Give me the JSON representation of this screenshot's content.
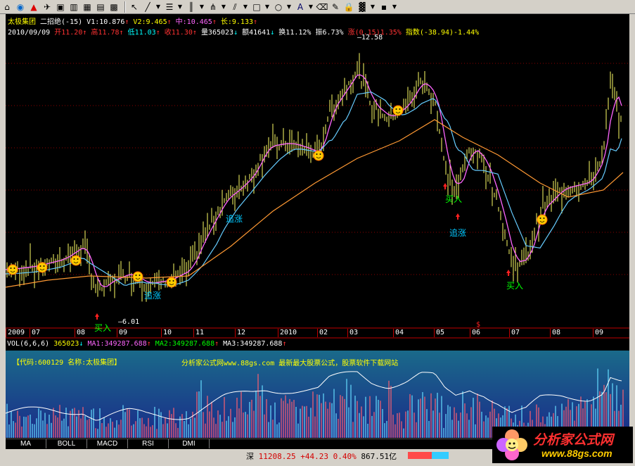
{
  "toolbar": {
    "icons": [
      "home-icon",
      "globe-icon",
      "alert-icon",
      "satellite-icon",
      "window-icon",
      "layout-icon",
      "grid-icon",
      "table-icon",
      "grid-blue-icon",
      "pointer-icon",
      "line-icon",
      "hline-icon",
      "vlines-icon",
      "fan-icon",
      "parallel-icon",
      "rectangle-icon",
      "circle-icon",
      "text-icon",
      "eraser-icon",
      "pencil-icon",
      "lock-icon",
      "palette-icon",
      "save-icon"
    ]
  },
  "header": {
    "stock_name": "太极集团",
    "indicator": "二招绝(-15)",
    "v1": "V1:10.876",
    "v2": "V2:9.465",
    "mid": "中:10.465",
    "long": "长:9.133",
    "date": "2010/09/09",
    "open": "开11.20",
    "high": "高11.78",
    "low": "低11.03",
    "close": "收11.30",
    "volume": "量365023",
    "amount": "额41641",
    "turnover": "换11.12%",
    "amplitude": "振6.73%",
    "change": "涨(0.15)1.35%",
    "index": "指数(-38.94)-1.44%"
  },
  "price_labels": {
    "max": "12.58",
    "min": "6.01"
  },
  "signals": [
    {
      "text": "追涨",
      "color": "#00c8ff"
    },
    {
      "text": "追涨",
      "color": "#00c8ff"
    },
    {
      "text": "买入",
      "color": "#00ff00"
    },
    {
      "text": "买入",
      "color": "#00ff00"
    },
    {
      "text": "追涨",
      "color": "#00c8ff"
    },
    {
      "text": "买入",
      "color": "#00ff00"
    },
    {
      "text": "买入",
      "color": "#00ff00"
    }
  ],
  "x_axis": [
    "2009",
    "07",
    "08",
    "09",
    "10",
    "11",
    "12",
    "2010",
    "02",
    "03",
    "04",
    "05",
    "06",
    "07",
    "08",
    "09"
  ],
  "volume_header": {
    "vol": "VOL(6,6,6)",
    "vol_value": "365023",
    "ma1": "MA1:349287.688",
    "ma2": "MA2:349287.688",
    "ma3": "MA3:349287.688"
  },
  "volume_panel": {
    "code_info": "【代码:600129 名称:太极集团】",
    "promo": "分析家公式网www.88gs.com 最新最大股票公式，股票软件下载网站"
  },
  "bottom_tabs": [
    "MA",
    "BOLL",
    "MACD",
    "RSI",
    "DMI"
  ],
  "status": {
    "market": "深",
    "value": "11208.25",
    "change": "+44.23",
    "pct": "0.40%",
    "amount": "867.51亿"
  },
  "logo": {
    "text": "分析家公式网",
    "url": "www.88gs.com"
  },
  "colors": {
    "up": "#ff3232",
    "down": "#00ffff",
    "candle": "#ffff66",
    "ma_pink": "#ff66ff",
    "ma_blue": "#66ccff",
    "ma_orange": "#ff9933",
    "header_yellow": "#ffff00"
  }
}
